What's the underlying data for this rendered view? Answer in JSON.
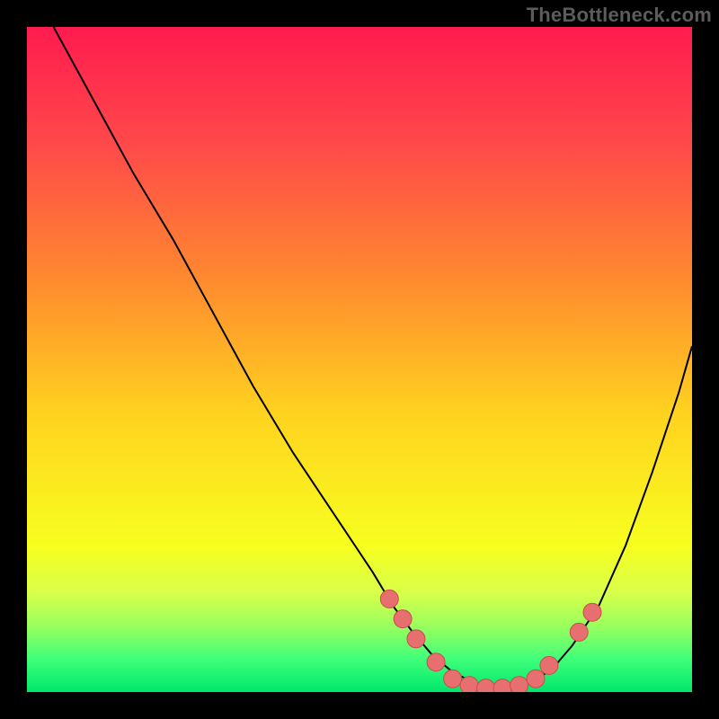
{
  "attribution": "TheBottleneck.com",
  "colors": {
    "curve": "#000000",
    "marker_fill": "#e76f6f",
    "marker_stroke": "#c94d4d",
    "gradient_stops": [
      {
        "offset": 0.0,
        "color": "#ff1b4f"
      },
      {
        "offset": 0.18,
        "color": "#ff4a4a"
      },
      {
        "offset": 0.38,
        "color": "#ff8a2f"
      },
      {
        "offset": 0.58,
        "color": "#ffd21f"
      },
      {
        "offset": 0.78,
        "color": "#f7ff1f"
      },
      {
        "offset": 0.85,
        "color": "#d9ff4a"
      },
      {
        "offset": 0.9,
        "color": "#9aff5d"
      },
      {
        "offset": 0.95,
        "color": "#40ff7a"
      },
      {
        "offset": 1.0,
        "color": "#00e76b"
      }
    ]
  },
  "chart_data": {
    "type": "line",
    "title": "",
    "xlabel": "",
    "ylabel": "",
    "xlim": [
      0,
      100
    ],
    "ylim": [
      0,
      100
    ],
    "grid": false,
    "series": [
      {
        "name": "bottleneck-curve",
        "x": [
          4,
          10,
          16,
          22,
          28,
          34,
          40,
          46,
          52,
          55,
          58,
          61,
          64,
          67,
          70,
          73,
          76,
          79,
          82,
          86,
          90,
          94,
          98,
          100
        ],
        "y": [
          100,
          89,
          78,
          68,
          57,
          46,
          36,
          27,
          18,
          13,
          9,
          5.5,
          3,
          1.5,
          0.7,
          0.7,
          1.5,
          3.5,
          7,
          13,
          22,
          33,
          45,
          52
        ]
      }
    ],
    "markers": {
      "name": "highlight-range",
      "points": [
        {
          "x": 54.5,
          "y": 14.0
        },
        {
          "x": 56.5,
          "y": 11.0
        },
        {
          "x": 58.5,
          "y": 8.0
        },
        {
          "x": 61.5,
          "y": 4.5
        },
        {
          "x": 64.0,
          "y": 2.0
        },
        {
          "x": 66.5,
          "y": 1.0
        },
        {
          "x": 69.0,
          "y": 0.6
        },
        {
          "x": 71.5,
          "y": 0.6
        },
        {
          "x": 74.0,
          "y": 1.0
        },
        {
          "x": 76.5,
          "y": 2.0
        },
        {
          "x": 78.5,
          "y": 4.0
        },
        {
          "x": 83.0,
          "y": 9.0
        },
        {
          "x": 85.0,
          "y": 12.0
        }
      ]
    }
  }
}
